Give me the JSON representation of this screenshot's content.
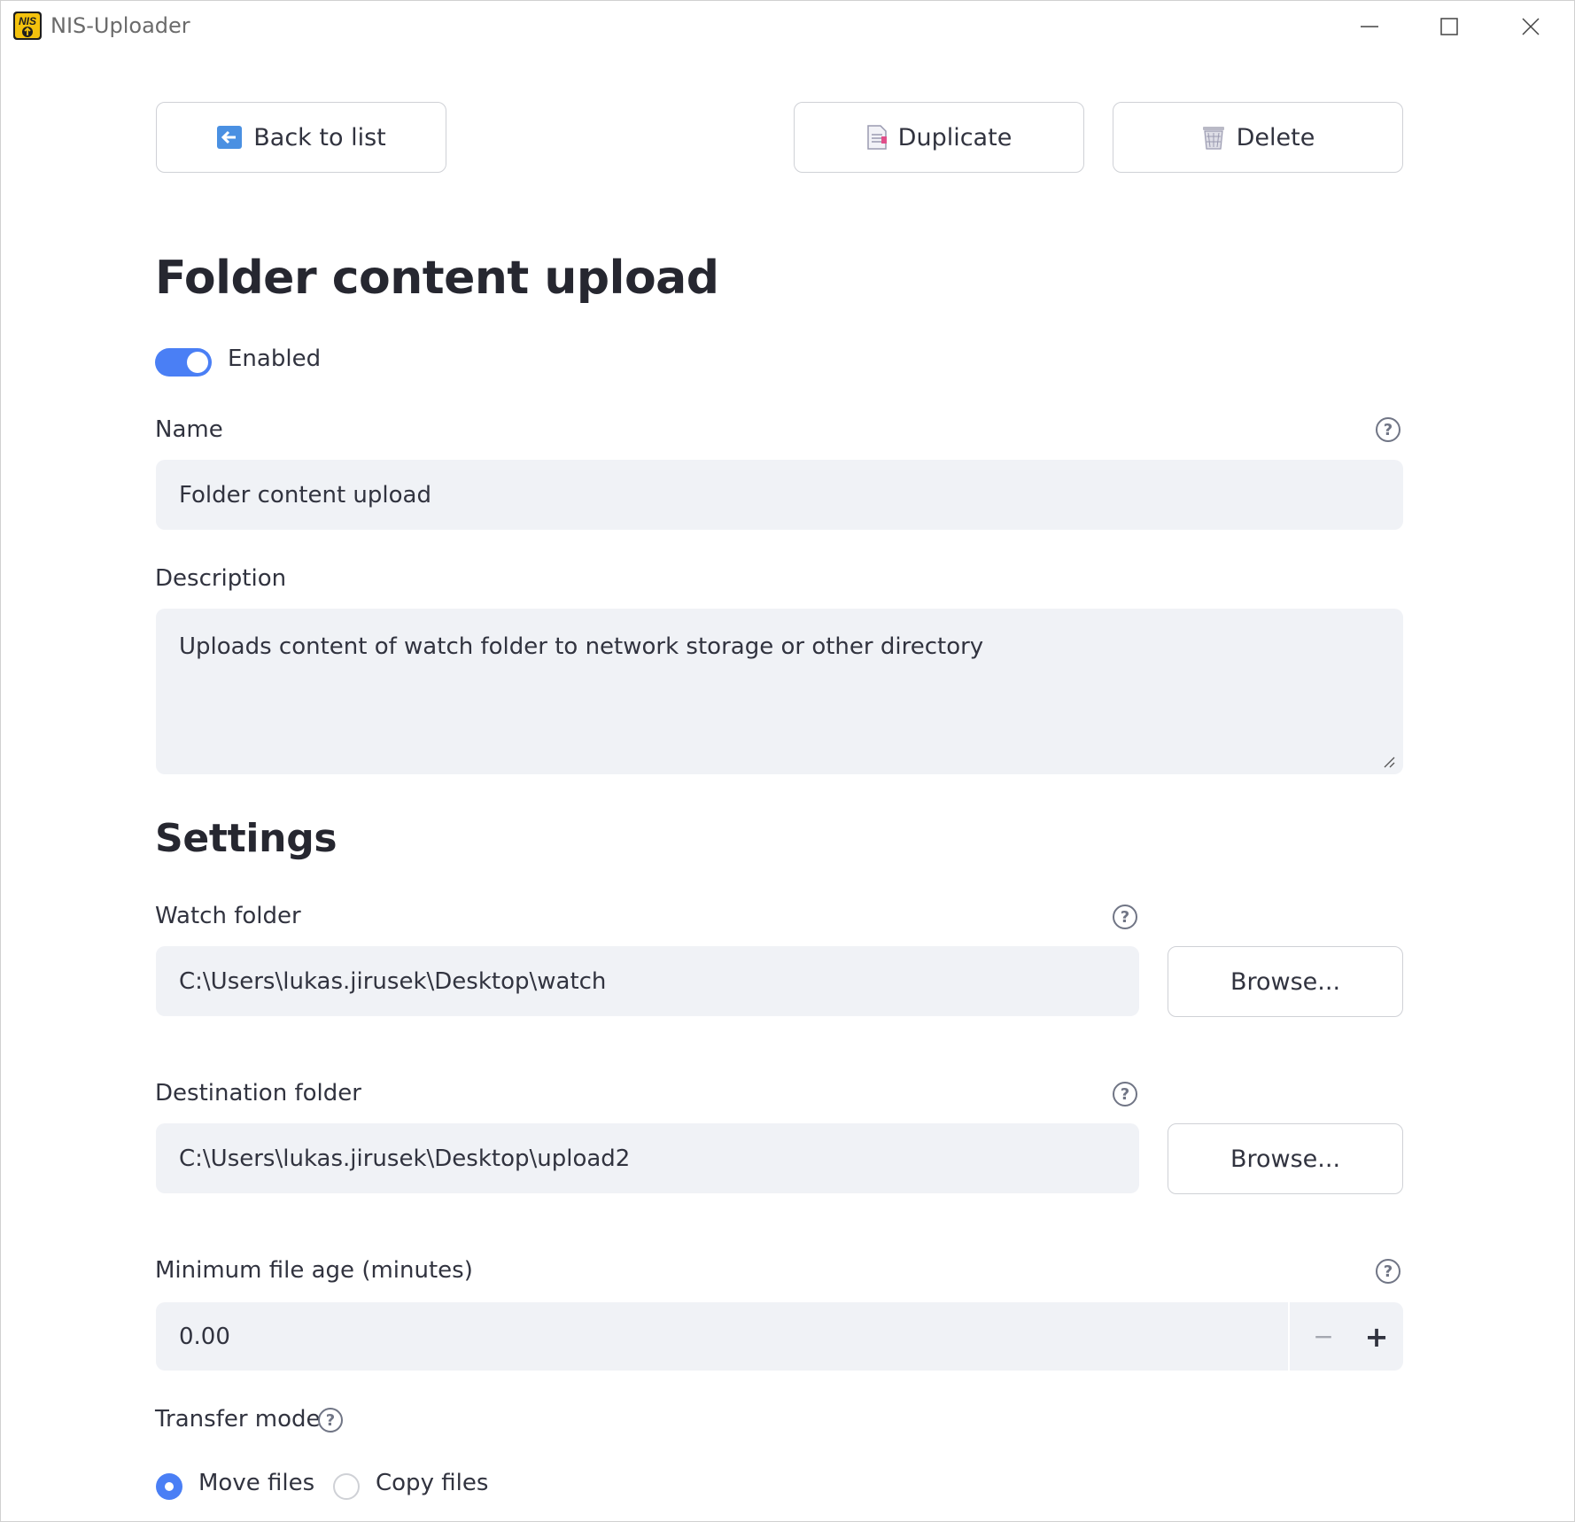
{
  "window": {
    "title": "NIS-Uploader",
    "app_icon_text": "NIS"
  },
  "toolbar": {
    "back_label": "Back to list",
    "duplicate_label": "Duplicate",
    "delete_label": "Delete"
  },
  "page": {
    "title": "Folder content upload"
  },
  "enabled": {
    "label": "Enabled",
    "value": true
  },
  "name_field": {
    "label": "Name",
    "value": "Folder content upload"
  },
  "description_field": {
    "label": "Description",
    "value": "Uploads content of watch folder to network storage or other directory"
  },
  "settings": {
    "title": "Settings",
    "watch_folder": {
      "label": "Watch folder",
      "value": "C:\\Users\\lukas.jirusek\\Desktop\\watch",
      "browse_label": "Browse..."
    },
    "destination_folder": {
      "label": "Destination folder",
      "value": "C:\\Users\\lukas.jirusek\\Desktop\\upload2",
      "browse_label": "Browse..."
    },
    "min_file_age": {
      "label": "Minimum file age (minutes)",
      "value": "0.00",
      "minus": "−",
      "plus": "+"
    },
    "transfer_mode": {
      "label": "Transfer mode",
      "options": [
        {
          "label": "Move files",
          "selected": true
        },
        {
          "label": "Copy files",
          "selected": false
        }
      ]
    }
  },
  "colors": {
    "accent": "#4a7ff5",
    "field_bg": "#f0f2f6",
    "text": "#31333f"
  }
}
